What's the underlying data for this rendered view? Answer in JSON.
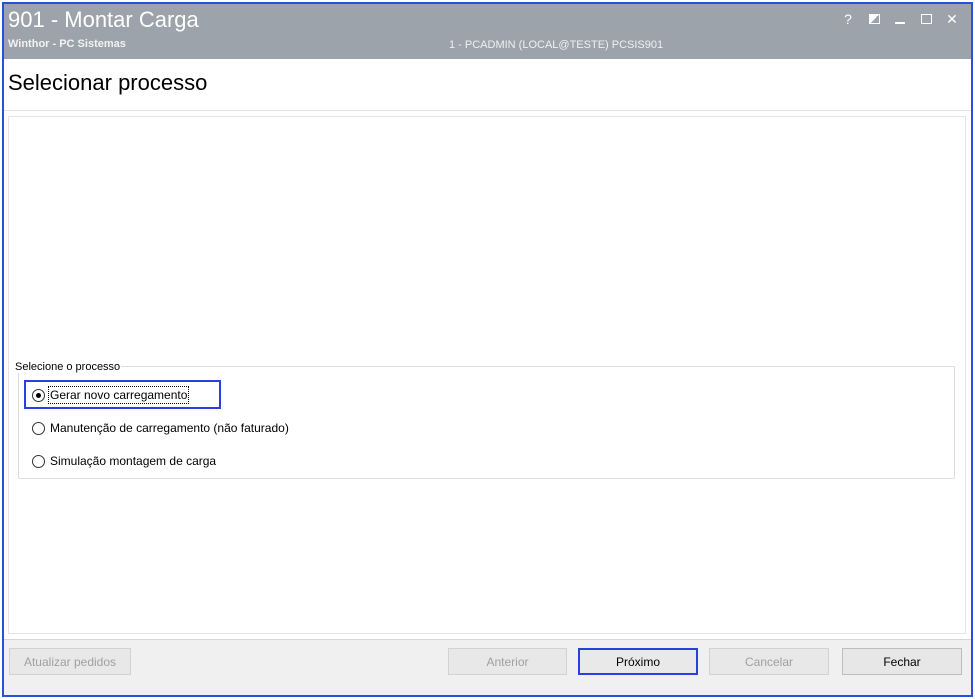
{
  "window": {
    "title": "901 - Montar Carga",
    "subtitle": "Winthor - PC Sistemas",
    "user_info": "1 - PCADMIN (LOCAL@TESTE)   PCSIS901",
    "controls": {
      "help": "?",
      "close": "✕"
    }
  },
  "page": {
    "heading": "Selecionar processo"
  },
  "process_group": {
    "legend": "Selecione o processo",
    "options": [
      {
        "label": "Gerar novo carregamento",
        "checked": true
      },
      {
        "label": "Manutenção de carregamento (não faturado)",
        "checked": false
      },
      {
        "label": "Simulação montagem de carga",
        "checked": false
      }
    ]
  },
  "footer": {
    "buttons": {
      "atualizar": "Atualizar pedidos",
      "anterior": "Anterior",
      "proximo": "Próximo",
      "cancelar": "Cancelar",
      "fechar": "Fechar"
    }
  },
  "colors": {
    "titlebar": "#9da3aa",
    "accent_border": "#2b3fe0"
  },
  "icons": [
    "help-icon",
    "restore-icon",
    "minimize-icon",
    "maximize-icon",
    "close-icon"
  ]
}
